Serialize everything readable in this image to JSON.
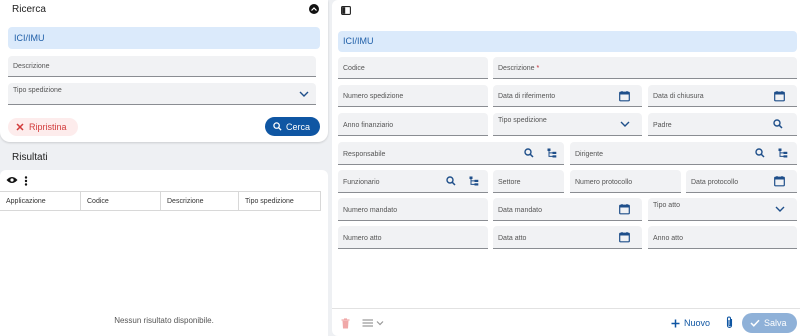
{
  "search": {
    "title": "Ricerca",
    "module_label": "ICI/IMU",
    "description_label": "Descrizione",
    "shipment_type_label": "Tipo spedizione",
    "reset_label": "Ripristina",
    "search_label": "Cerca"
  },
  "results": {
    "title": "Risultati",
    "columns": [
      "Applicazione",
      "Codice",
      "Descrizione",
      "Tipo spedizione"
    ],
    "empty_message": "Nessun risultato disponibile."
  },
  "form": {
    "module_label": "ICI/IMU",
    "fields": {
      "codice": "Codice",
      "descrizione": "Descrizione",
      "numero_spedizione": "Numero spedizione",
      "data_riferimento": "Data di riferimento",
      "data_chiusura": "Data di chiusura",
      "anno_finanziario": "Anno finanziario",
      "tipo_spedizione": "Tipo spedizione",
      "padre": "Padre",
      "responsabile": "Responsabile",
      "dirigente": "Dirigente",
      "funzionario": "Funzionario",
      "settore": "Settore",
      "numero_protocollo": "Numero protocollo",
      "data_protocollo": "Data protocollo",
      "numero_mandato": "Numero mandato",
      "data_mandato": "Data mandato",
      "tipo_atto": "Tipo atto",
      "numero_atto": "Numero atto",
      "data_atto": "Data atto",
      "anno_atto": "Anno atto"
    },
    "required_mark": "*"
  },
  "footer": {
    "new_label": "Nuovo",
    "save_label": "Salva"
  },
  "colors": {
    "primary": "#0f56a3",
    "module_bg": "#dbeafb",
    "danger": "#d23b3b",
    "save_disabled": "#8fb1d8"
  }
}
